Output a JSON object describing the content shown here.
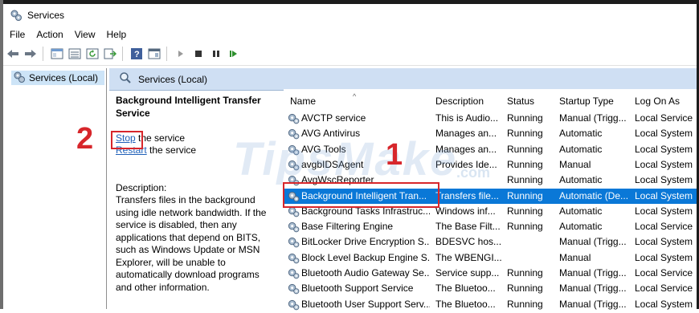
{
  "window": {
    "title": "Services"
  },
  "menu": [
    "File",
    "Action",
    "View",
    "Help"
  ],
  "tree": {
    "root_label": "Services (Local)"
  },
  "main": {
    "header_label": "Services (Local)",
    "selected_service_title": "Background Intelligent Transfer Service",
    "stop_link": "Stop",
    "stop_suffix": " the service",
    "restart_link": "Restart",
    "restart_suffix": " the service",
    "description_label": "Description:",
    "description_text": "Transfers files in the background using idle network bandwidth. If the service is disabled, then any applications that depend on BITS, such as Windows Update or MSN Explorer, will be unable to automatically download programs and other information."
  },
  "columns": {
    "name": "Name",
    "description": "Description",
    "status": "Status",
    "startup": "Startup Type",
    "logon": "Log On As"
  },
  "rows": [
    {
      "name": "AVCTP service",
      "desc": "This is Audio...",
      "status": "Running",
      "startup": "Manual (Trigg...",
      "logon": "Local Service"
    },
    {
      "name": "AVG Antivirus",
      "desc": "Manages an...",
      "status": "Running",
      "startup": "Automatic",
      "logon": "Local System"
    },
    {
      "name": "AVG Tools",
      "desc": "Manages an...",
      "status": "Running",
      "startup": "Automatic",
      "logon": "Local System"
    },
    {
      "name": "avgbIDSAgent",
      "desc": "Provides Ide...",
      "status": "Running",
      "startup": "Manual",
      "logon": "Local System"
    },
    {
      "name": "AvgWscReporter",
      "desc": "",
      "status": "Running",
      "startup": "Automatic",
      "logon": "Local System"
    },
    {
      "name": "Background Intelligent Tran...",
      "desc": "Transfers file...",
      "status": "Running",
      "startup": "Automatic (De...",
      "logon": "Local System"
    },
    {
      "name": "Background Tasks Infrastruc...",
      "desc": "Windows inf...",
      "status": "Running",
      "startup": "Automatic",
      "logon": "Local System"
    },
    {
      "name": "Base Filtering Engine",
      "desc": "The Base Filt...",
      "status": "Running",
      "startup": "Automatic",
      "logon": "Local Service"
    },
    {
      "name": "BitLocker Drive Encryption S...",
      "desc": "BDESVC hos...",
      "status": "",
      "startup": "Manual (Trigg...",
      "logon": "Local System"
    },
    {
      "name": "Block Level Backup Engine S...",
      "desc": "The WBENGI...",
      "status": "",
      "startup": "Manual",
      "logon": "Local System"
    },
    {
      "name": "Bluetooth Audio Gateway Se...",
      "desc": "Service supp...",
      "status": "Running",
      "startup": "Manual (Trigg...",
      "logon": "Local Service"
    },
    {
      "name": "Bluetooth Support Service",
      "desc": "The Bluetoo...",
      "status": "Running",
      "startup": "Manual (Trigg...",
      "logon": "Local Service"
    },
    {
      "name": "Bluetooth User Support Serv...",
      "desc": "The Bluetoo...",
      "status": "Running",
      "startup": "Manual (Trigg...",
      "logon": "Local System"
    }
  ],
  "selected_row_index": 5,
  "annotations": {
    "step1": "1",
    "step2": "2"
  },
  "watermark": {
    "main": "TipsMake",
    "sub": ".com"
  },
  "colors": {
    "selection": "#0a78d7",
    "callout": "#d7262b",
    "header_band": "#cfdff3"
  }
}
